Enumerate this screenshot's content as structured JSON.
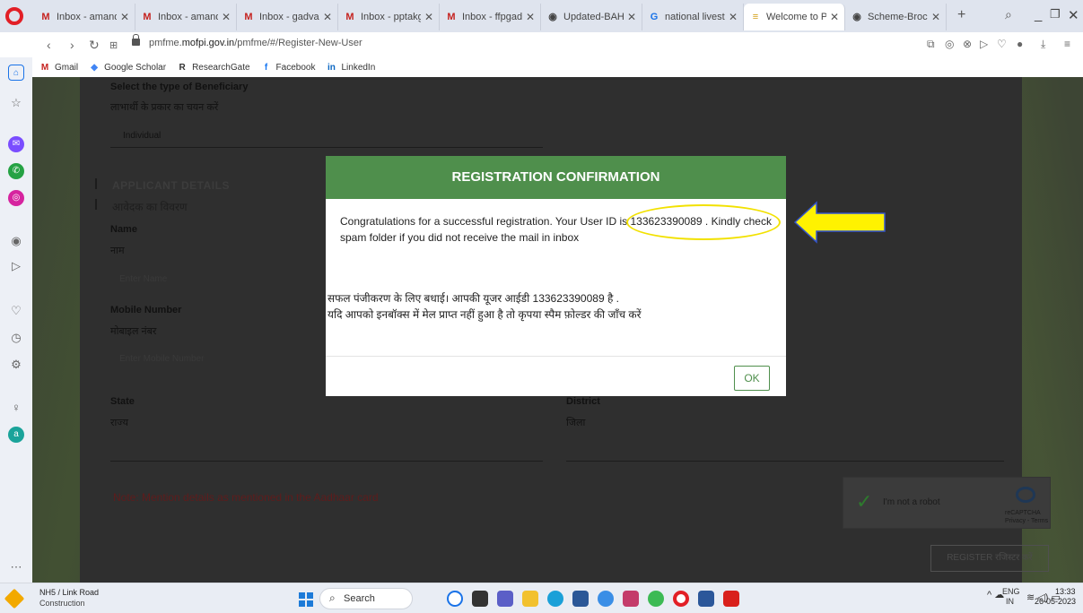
{
  "browser": {
    "tabs": [
      {
        "icon": "gmail-icon",
        "label": "Inbox - amande",
        "color": "#c5221f",
        "glyph": "M"
      },
      {
        "icon": "gmail-icon",
        "label": "Inbox - amande",
        "color": "#c5221f",
        "glyph": "M"
      },
      {
        "icon": "gmail-icon",
        "label": "Inbox - gadvasu",
        "color": "#c5221f",
        "glyph": "M"
      },
      {
        "icon": "gmail-icon",
        "label": "Inbox - pptakga",
        "color": "#c5221f",
        "glyph": "M"
      },
      {
        "icon": "gmail-icon",
        "label": "Inbox - ffpgadv",
        "color": "#c5221f",
        "glyph": "M"
      },
      {
        "icon": "globe-icon",
        "label": "Updated-BAHS-",
        "color": "#444444",
        "glyph": "◉"
      },
      {
        "icon": "google-icon",
        "label": "national livesto",
        "color": "#1a73e8",
        "glyph": "G"
      },
      {
        "icon": "site-icon",
        "label": "Welcome to PM",
        "color": "#d4a017",
        "glyph": "≡"
      },
      {
        "icon": "globe-icon",
        "label": "Scheme-Brochu",
        "color": "#444444",
        "glyph": "◉"
      }
    ],
    "close_glyph": "✕",
    "new_tab": "+",
    "url_prefix": "pmfme.",
    "url_domain": "mofpi.gov.in",
    "url_path": "/pmfme/#/Register-New-User",
    "bookmarks": [
      {
        "icon": "gmail-icon",
        "label": "Gmail",
        "color": "#c5221f",
        "glyph": "M"
      },
      {
        "icon": "scholar-icon",
        "label": "Google Scholar",
        "color": "#4285f4",
        "glyph": "◆"
      },
      {
        "icon": "researchgate-icon",
        "label": "ResearchGate",
        "color": "#333333",
        "glyph": "R"
      },
      {
        "icon": "facebook-icon",
        "label": "Facebook",
        "color": "#1877f2",
        "glyph": "f"
      },
      {
        "icon": "linkedin-icon",
        "label": "LinkedIn",
        "color": "#0a66c2",
        "glyph": "in"
      }
    ]
  },
  "form": {
    "beneficiary_label": "Select the type of Beneficiary",
    "beneficiary_hindi": "लाभार्थी के प्रकार का चयन करें",
    "beneficiary_value": "Individual",
    "section_title": "APPLICANT DETAILS",
    "section_hindi": "आवेदक का विवरण",
    "name_label": "Name",
    "name_hindi": "नाम",
    "name_placeholder": "Enter Name",
    "mobile_label": "Mobile Number",
    "mobile_hindi": "मोबाइल नंबर",
    "mobile_placeholder": "Enter Mobile Number",
    "state_label": "State",
    "state_hindi": "राज्य",
    "district_label": "District",
    "district_hindi": "जिला",
    "note": "Note: Mention details as mentioned in the Aadhaar card",
    "captcha_label": "I'm not a robot",
    "captcha_brand": "reCAPTCHA",
    "captcha_links": "Privacy - Terms",
    "register_label": "REGISTER रजिस्टर करें"
  },
  "modal": {
    "title": "REGISTRATION CONFIRMATION",
    "message_en": "Congratulations for a successful registration. Your User ID is 133623390089 . Kindly check spam folder if you did not receive the mail in inbox",
    "message_hi_1": "सफल पंजीकरण के लिए बधाई। आपकी यूजर आईडी 133623390089 है .",
    "message_hi_2": "यदि आपको इनबॉक्स में मेल प्राप्त नहीं हुआ है तो कृपया स्पैम फ़ोल्डर की जाँच करें",
    "ok_label": "OK",
    "user_id": "133623390089",
    "highlight_color": "#f2e100"
  },
  "taskbar": {
    "weather_title": "NH5 / Link Road",
    "weather_sub": "Construction",
    "search_label": "Search",
    "lang_1": "ENG",
    "lang_2": "IN",
    "time": "13:33",
    "date": "26-05-2023"
  }
}
